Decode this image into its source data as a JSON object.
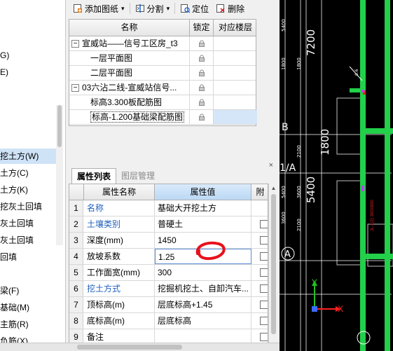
{
  "left_nav": {
    "items": [
      {
        "label": "G)"
      },
      {
        "label": "E)"
      },
      {
        "label": "挖土方(W)",
        "selected": true
      },
      {
        "label": "土方(C)"
      },
      {
        "label": "土方(K)"
      },
      {
        "label": "挖灰土回填"
      },
      {
        "label": "灰土回填"
      },
      {
        "label": "灰土回填"
      },
      {
        "label": "回填"
      },
      {
        "label": "梁(F)"
      },
      {
        "label": "基础(M)"
      },
      {
        "label": "主筋(R)"
      },
      {
        "label": "负筋(X)"
      }
    ]
  },
  "toolbar": {
    "add_drawing": "添加图纸",
    "split": "分割",
    "locate": "定位",
    "delete": "删除"
  },
  "drawing_tree": {
    "headers": {
      "name": "名称",
      "lock": "锁定",
      "floor": "对应楼层"
    },
    "rows": [
      {
        "label": "宣威站——信号工区房_t3",
        "expander": "−",
        "indent": 0,
        "selected": false
      },
      {
        "label": "一层平面图",
        "expander": "",
        "indent": 1,
        "selected": false
      },
      {
        "label": "二层平面图",
        "expander": "",
        "indent": 1,
        "selected": false
      },
      {
        "label": "03六沾二线-宣威站信号...",
        "expander": "−",
        "indent": 0,
        "selected": false
      },
      {
        "label": "标高3.300板配筋图",
        "expander": "",
        "indent": 1,
        "selected": false
      },
      {
        "label": "标高-1.200基础梁配筋图",
        "expander": "",
        "indent": 1,
        "selected": true
      }
    ]
  },
  "properties": {
    "tabs": [
      "属性列表",
      "图层管理"
    ],
    "close_symbol": "×",
    "headers": {
      "name": "属性名称",
      "value": "属性值",
      "attach": "附"
    },
    "rows": [
      {
        "num": "1",
        "name": "名称",
        "value": "基础大开挖土方",
        "blue": true,
        "checkbox": false
      },
      {
        "num": "2",
        "name": "土壤类别",
        "value": "普硬土",
        "blue": true,
        "checkbox": true
      },
      {
        "num": "3",
        "name": "深度(mm)",
        "value": "1450",
        "blue": false,
        "checkbox": true
      },
      {
        "num": "4",
        "name": "放坡系数",
        "value": "1.25",
        "blue": false,
        "checkbox": true,
        "editing": true
      },
      {
        "num": "5",
        "name": "工作面宽(mm)",
        "value": "300",
        "blue": false,
        "checkbox": true
      },
      {
        "num": "6",
        "name": "挖土方式",
        "value": "挖掘机挖土、自卸汽车...",
        "blue": true,
        "checkbox": true
      },
      {
        "num": "7",
        "name": "顶标高(m)",
        "value": "层底标高+1.45",
        "blue": false,
        "checkbox": true
      },
      {
        "num": "8",
        "name": "底标高(m)",
        "value": "层底标高",
        "blue": false,
        "checkbox": true
      },
      {
        "num": "9",
        "name": "备注",
        "value": "",
        "blue": false,
        "checkbox": true
      }
    ]
  },
  "cad": {
    "dim_7200": "7200",
    "dim_1800": "1800",
    "dim_5400": "5400",
    "small_5400": "5400",
    "small_1800": "1800",
    "small_3600": "3600",
    "small_2100": "2100",
    "axis_b": "B",
    "axis_1a": "1/A",
    "axis_a": "A",
    "label_x": "X",
    "label_y": "Y",
    "annotation": "0.6",
    "red_note": "JL-1(2) 300X650",
    "colors": {
      "beam": "#22d04a",
      "grid": "#ffffff",
      "red": "#e02020",
      "axis_x": "#ff2020",
      "axis_y": "#20c020",
      "origin": "#3b6cff"
    }
  },
  "annotation_overlay": {
    "color": "#e8101a"
  }
}
